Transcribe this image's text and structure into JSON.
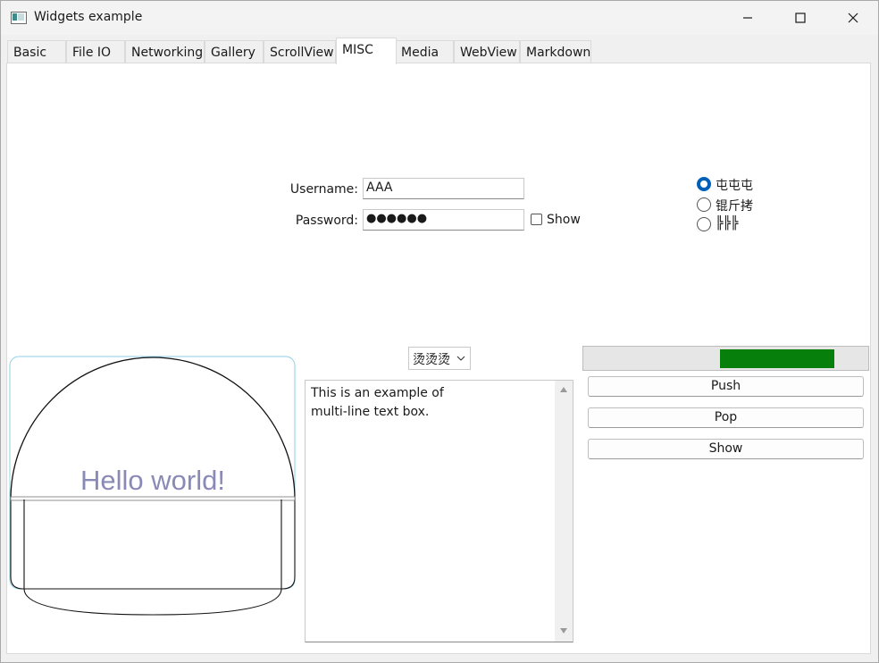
{
  "window": {
    "title": "Widgets example"
  },
  "tabs": [
    {
      "label": "Basic"
    },
    {
      "label": "File IO"
    },
    {
      "label": "Networking"
    },
    {
      "label": "Gallery"
    },
    {
      "label": "ScrollView"
    },
    {
      "label": "MISC",
      "active": true
    },
    {
      "label": "Media"
    },
    {
      "label": "WebView"
    },
    {
      "label": "Markdown"
    }
  ],
  "login": {
    "username_label": "Username:",
    "username_value": "AAA",
    "password_label": "Password:",
    "password_value": "●●●●●●",
    "show_label": "Show",
    "show_checked": false
  },
  "radios": [
    {
      "label": "屯屯屯",
      "checked": true
    },
    {
      "label": "锟斤拷",
      "checked": false
    },
    {
      "label": "╠╠╠",
      "checked": false
    }
  ],
  "combo": {
    "selected": "烫烫烫"
  },
  "textbox": {
    "lines": [
      "This is an example of",
      "multi-line text box."
    ]
  },
  "canvas": {
    "text": "Hello world!"
  },
  "progress": {
    "chunk_start": 0.48,
    "chunk_end": 0.88,
    "color": "#06800b"
  },
  "buttons": {
    "push": "Push",
    "pop": "Pop",
    "show": "Show"
  },
  "colors": {
    "accent": "#005fb8",
    "progress": "#06800b"
  }
}
